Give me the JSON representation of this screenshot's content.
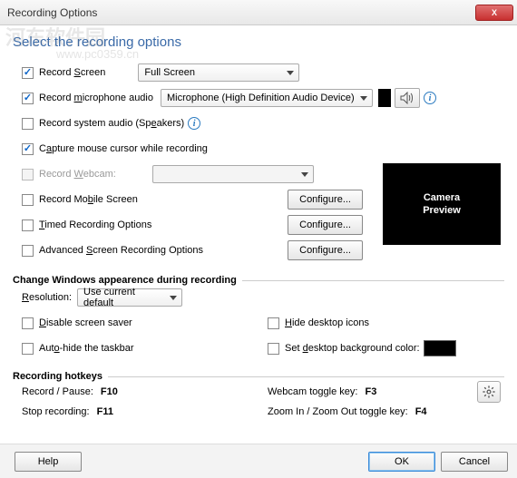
{
  "window": {
    "title": "Recording Options",
    "close": "X"
  },
  "subtitle": "Select the recording options",
  "watermark": {
    "main": "河东软件园",
    "sub": "www.pc0359.cn"
  },
  "recordScreen": {
    "label_pre": "Record ",
    "accel": "S",
    "label_post": "creen",
    "checked": true,
    "select": "Full Screen"
  },
  "recordMic": {
    "label": "Record microphone audio",
    "accel": "m",
    "label_pre": "Record ",
    "label_post": "icrophone audio",
    "checked": true,
    "select": "Microphone (High Definition Audio Device)"
  },
  "recordSystem": {
    "label_pre": "Record system audio (Sp",
    "accel": "e",
    "label_post": "akers)",
    "checked": false
  },
  "captureCursor": {
    "label_pre": "C",
    "accel": "a",
    "label_post": "pture mouse cursor while recording",
    "checked": true
  },
  "recordWebcam": {
    "label_pre": "Record ",
    "accel": "W",
    "label_post": "ebcam:",
    "disabled": true
  },
  "recordMobile": {
    "label_pre": "Record Mo",
    "accel": "b",
    "label_post": "ile Screen",
    "checked": false,
    "configure": "Configure..."
  },
  "timedRec": {
    "label_pre": "",
    "accel": "T",
    "label_post": "imed Recording Options",
    "checked": false,
    "configure": "Configure..."
  },
  "advanced": {
    "label_pre": "Advanced ",
    "accel": "S",
    "label_post": "creen Recording Options",
    "checked": false,
    "configure": "Configure..."
  },
  "preview": "Camera\nPreview",
  "section_appearance": "Change Windows appearence during recording",
  "resolution": {
    "label_pre": "",
    "accel": "R",
    "label_post": "esolution:",
    "select": "Use current default"
  },
  "disableSaver": {
    "label_pre": "",
    "accel": "D",
    "label_post": "isable screen saver"
  },
  "autoHideTaskbar": {
    "label_pre": "Aut",
    "accel": "o",
    "label_post": "-hide the taskbar"
  },
  "hideIcons": {
    "label_pre": "",
    "accel": "H",
    "label_post": "ide desktop icons"
  },
  "setBgColor": {
    "label_pre": "Set ",
    "accel": "d",
    "label_post": "esktop background color:"
  },
  "section_hotkeys": "Recording hotkeys",
  "hotkeys": {
    "recordPause": {
      "label": "Record / Pause:",
      "key": "F10"
    },
    "stop": {
      "label": "Stop recording:",
      "key": "F11"
    },
    "webcamToggle": {
      "label": "Webcam toggle key:",
      "key": "F3"
    },
    "zoomToggle": {
      "label": "Zoom In / Zoom Out toggle key:",
      "key": "F4"
    }
  },
  "buttons": {
    "help": "Help",
    "ok": "OK",
    "cancel": "Cancel"
  }
}
